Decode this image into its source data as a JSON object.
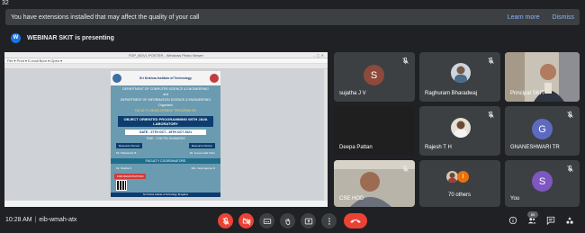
{
  "corner_number": "32",
  "extensions_banner": {
    "message": "You have extensions installed that may affect the quality of your call",
    "learn_more": "Learn more",
    "dismiss": "Dismiss"
  },
  "presenting_bar": {
    "badge_letter": "W",
    "text": "WEBINAR SKIT is presenting"
  },
  "presentation": {
    "window_title": "FDP_BGVL POSTER - Windows Photo Viewer",
    "menu": "File  ▾  Print  ▾  E-mail    Burn  ▾  Open  ▾",
    "poster": {
      "institution": "Sri Krishna Institute of Technology",
      "lines": [
        "DEPARTMENT OF COMPUTER SCIENCE & ENGINEERING",
        "and",
        "DEPARTMENT OF INFORMATION SCIENCE & ENGINEERING",
        "Organizes"
      ],
      "program": "FACULTY DEVELOPMENT PROGRAM ON",
      "title": "OBJECT ORIENTED PROGRAMMING WITH JAVA LABORATORY",
      "date": "DATE : 27TH OCT - 29TH OCT 2021",
      "time": "TIME : 2:30 PM ONWARDS",
      "speaker_label_left": "Resource Person",
      "speaker_label_right": "Resource Person",
      "speaker_left": "Mr. Pakirandor B",
      "speaker_right": "Mr. Jeevan Alla Khan",
      "coordinator_heading": "FACULTY COORDINATORS",
      "coordinator_left": "Mr. Shaiba S",
      "coordinator_right": "Mrs. Supriyapriya D",
      "registration": "FOR REGISTRATION",
      "footer": "Sri Krishna Institute of Technology, Bengaluru"
    }
  },
  "participants": [
    {
      "name": "sujatha J V",
      "initial": "S",
      "color": "#8d4a3c",
      "type": "avatar"
    },
    {
      "name": "Raghuram Bharadwaj",
      "type": "photo"
    },
    {
      "name": "Principal SKIT",
      "type": "video"
    },
    {
      "name": "Deepa Pattan",
      "type": "dark"
    },
    {
      "name": "Rajesh T H",
      "type": "photo"
    },
    {
      "name": "GNANESHWARI TR",
      "initial": "G",
      "color": "#5c6bc0",
      "type": "avatar"
    },
    {
      "name": "CSE HOD",
      "type": "video"
    },
    {
      "name": "70 others",
      "type": "others"
    },
    {
      "name": "You",
      "initial": "S",
      "color": "#7e57c2",
      "type": "avatar"
    }
  ],
  "bottom_bar": {
    "time": "10:28 AM",
    "separator": "|",
    "meeting_code": "eib-wmah-atx",
    "participant_count": "80"
  },
  "icons": {
    "mic_off": "mic-off-icon",
    "cam_off": "camera-off-icon",
    "captions": "captions-icon",
    "hand": "raise-hand-icon",
    "present": "present-icon",
    "more": "more-options-icon",
    "end_call": "end-call-icon",
    "info": "info-icon",
    "people": "people-icon",
    "chat": "chat-icon",
    "activities": "activities-icon"
  }
}
